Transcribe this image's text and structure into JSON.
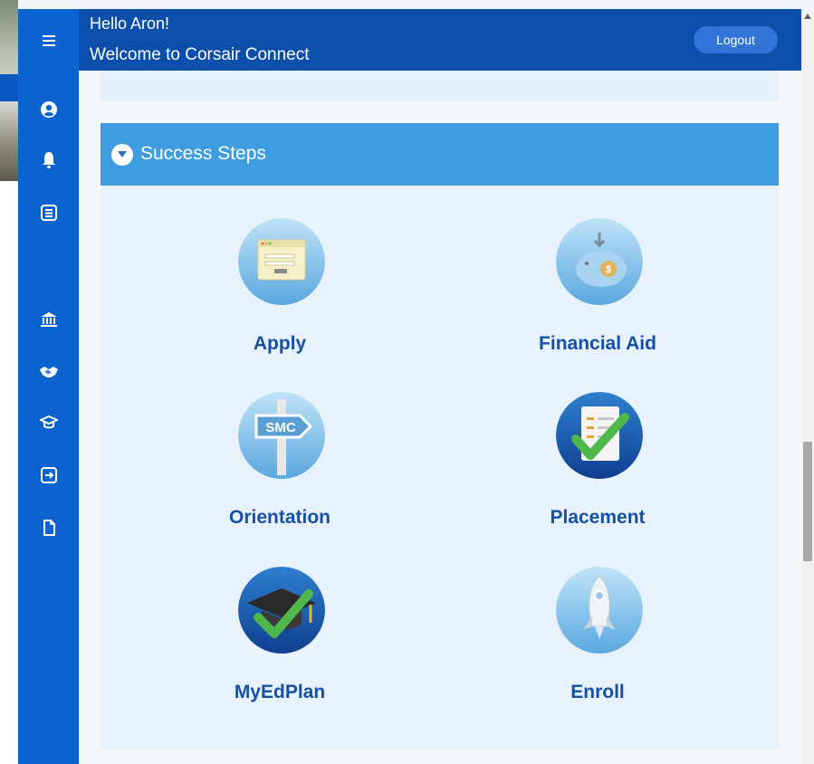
{
  "header": {
    "greeting": "Hello Aron!",
    "welcome": "Welcome to Corsair Connect",
    "logout_label": "Logout"
  },
  "sidebar": {
    "items": [
      {
        "icon": "menu-icon"
      },
      {
        "icon": "user-icon"
      },
      {
        "icon": "bell-icon"
      },
      {
        "icon": "list-icon"
      },
      {
        "icon": "bank-icon"
      },
      {
        "icon": "handshake-icon"
      },
      {
        "icon": "graduation-cap-icon"
      },
      {
        "icon": "sign-out-icon"
      },
      {
        "icon": "file-icon"
      }
    ]
  },
  "panel": {
    "title": "Success Steps",
    "steps": [
      {
        "label": "Apply",
        "icon": "application-form-icon"
      },
      {
        "label": "Financial Aid",
        "icon": "piggy-bank-icon"
      },
      {
        "label": "Orientation",
        "icon": "smc-signpost-icon",
        "sign_text": "SMC"
      },
      {
        "label": "Placement",
        "icon": "checklist-icon"
      },
      {
        "label": "MyEdPlan",
        "icon": "graduation-cap-check-icon"
      },
      {
        "label": "Enroll",
        "icon": "rocket-icon"
      }
    ]
  },
  "colors": {
    "sidebar": "#0b63cf",
    "header": "#0b4faa",
    "panel_header": "#3d9de0",
    "label": "#1550a3"
  }
}
